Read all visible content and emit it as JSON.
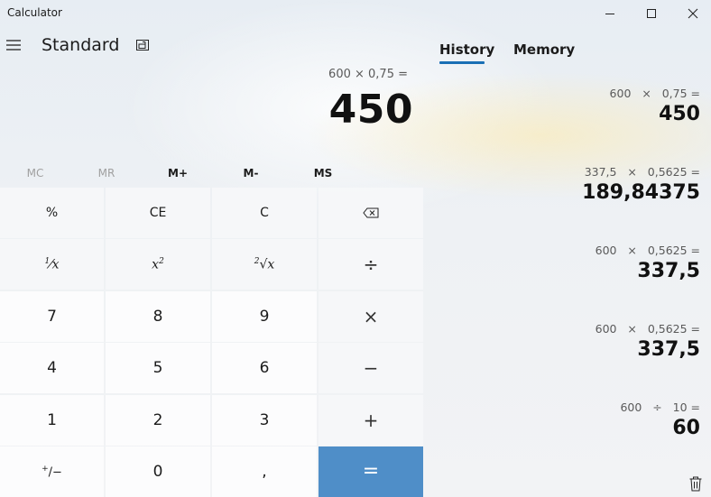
{
  "window": {
    "title": "Calculator",
    "controls": [
      "minimize-icon",
      "maximize-icon",
      "close-icon"
    ]
  },
  "header": {
    "mode": "Standard",
    "menu_icon": "hamburger-menu-icon",
    "keep_on_top_icon": "keep-on-top-icon"
  },
  "display": {
    "expression": "600 × 0,75 =",
    "result": "450"
  },
  "memory": {
    "mc": "MC",
    "mr": "MR",
    "mplus": "M+",
    "mminus": "M-",
    "ms": "MS"
  },
  "keys": {
    "percent": "%",
    "ce": "CE",
    "c": "C",
    "backspace_icon": "backspace-icon",
    "reciprocal_num": "1",
    "reciprocal_den": "x",
    "square_base": "x",
    "square_exp": "2",
    "sqrt_index": "2",
    "sqrt_radicand": "x",
    "divide": "÷",
    "multiply": "×",
    "subtract": "−",
    "add": "+",
    "equals": "=",
    "seven": "7",
    "eight": "8",
    "nine": "9",
    "four": "4",
    "five": "5",
    "six": "6",
    "one": "1",
    "two": "2",
    "three": "3",
    "negate_plus": "+",
    "negate_minus": "/−",
    "zero": "0",
    "decimal": ","
  },
  "tabs": {
    "history": "History",
    "memory": "Memory",
    "active": "history"
  },
  "history": [
    {
      "expression": "600   ×   0,75 =",
      "result": "450"
    },
    {
      "expression": "337,5   ×   0,5625 =",
      "result": "189,84375"
    },
    {
      "expression": "600   ×   0,5625 =",
      "result": "337,5"
    },
    {
      "expression": "600   ×   0,5625 =",
      "result": "337,5"
    },
    {
      "expression": "600   ÷   10 =",
      "result": "60"
    }
  ],
  "colors": {
    "accent": "#1a6fb5",
    "equals_button": "#4f8ec8"
  },
  "clear_history_icon": "trash-icon"
}
